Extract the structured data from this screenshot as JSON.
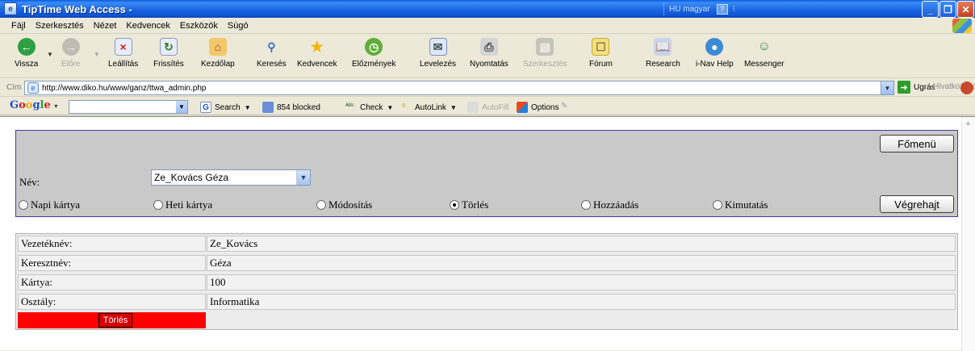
{
  "window": {
    "title": "TipTime Web Access -",
    "language": "HU magyar"
  },
  "menu": [
    "Fájl",
    "Szerkesztés",
    "Nézet",
    "Kedvencek",
    "Eszközök",
    "Súgó"
  ],
  "toolbar": {
    "back": "Vissza",
    "forward": "Előre",
    "stop": "Leállítás",
    "refresh": "Frissítés",
    "home": "Kezdőlap",
    "search": "Keresés",
    "favorites": "Kedvencek",
    "history": "Előzmények",
    "mail": "Levelezés",
    "print": "Nyomtatás",
    "edit": "Szerkesztés",
    "forum": "Fórum",
    "research": "Research",
    "inav": "i-Nav Help",
    "messenger": "Messenger"
  },
  "address": {
    "label": "Cím",
    "url": "http://www.diko.hu/www/ganz/ttwa_admin.php",
    "go": "Ugrás",
    "links": "Hivatkozások"
  },
  "google": {
    "logo": [
      "G",
      "o",
      "o",
      "g",
      "l",
      "e"
    ],
    "search": "Search",
    "blocked": "854 blocked",
    "check": "Check",
    "autolink": "AutoLink",
    "autofill": "AutoFill",
    "options": "Options"
  },
  "form": {
    "name_label": "Név:",
    "name_value": "Ze_Kovács Géza",
    "main_menu": "Főmenü",
    "execute": "Végrehajt",
    "options": [
      {
        "label": "Napi kártya",
        "selected": false
      },
      {
        "label": "Heti kártya",
        "selected": false
      },
      {
        "label": "Módosítás",
        "selected": false
      },
      {
        "label": "Törlés",
        "selected": true
      },
      {
        "label": "Hozzáadás",
        "selected": false
      },
      {
        "label": "Kimutatás",
        "selected": false
      }
    ]
  },
  "details": {
    "rows": [
      {
        "label": "Vezetéknév:",
        "value": "Ze_Kovács"
      },
      {
        "label": "Keresztnév:",
        "value": "Géza"
      },
      {
        "label": "Kártya:",
        "value": "100"
      },
      {
        "label": "Osztály:",
        "value": "Informatika"
      }
    ],
    "delete_button": "Törlés"
  }
}
